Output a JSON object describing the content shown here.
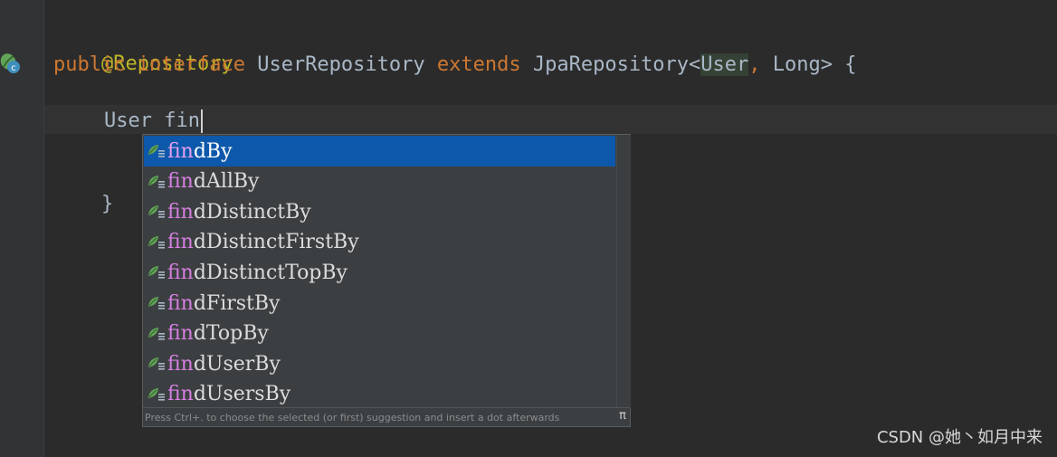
{
  "gutter": {
    "icon": "spring-repository-icon"
  },
  "code": {
    "line1": {
      "annotation": "@Repository"
    },
    "line2": {
      "kw_public": "public",
      "kw_interface": "interface",
      "name": "UserRepository",
      "kw_extends": "extends",
      "base": "JpaRepository",
      "lt": "<",
      "type1": "User",
      "comma": ",",
      "type2": "Long",
      "gt": ">",
      "brace": "{"
    },
    "line3": {
      "type": "User",
      "typed": "fin"
    },
    "line4": {
      "close_brace": "}"
    }
  },
  "completion": {
    "match_prefix": "fin",
    "items": [
      {
        "match": "fin",
        "rest": "dBy",
        "icon": "spring-method-icon",
        "selected": true
      },
      {
        "match": "fin",
        "rest": "dAllBy",
        "icon": "spring-method-icon"
      },
      {
        "match": "fin",
        "rest": "dDistinctBy",
        "icon": "spring-method-icon"
      },
      {
        "match": "fin",
        "rest": "dDistinctFirstBy",
        "icon": "spring-method-icon"
      },
      {
        "match": "fin",
        "rest": "dDistinctTopBy",
        "icon": "spring-method-icon"
      },
      {
        "match": "fin",
        "rest": "dFirstBy",
        "icon": "spring-method-icon"
      },
      {
        "match": "fin",
        "rest": "dTopBy",
        "icon": "spring-method-icon"
      },
      {
        "match": "fin",
        "rest": "dUserBy",
        "icon": "spring-method-icon"
      },
      {
        "match": "fin",
        "rest": "dUsersBy",
        "icon": "spring-method-icon"
      }
    ],
    "hint": "Press Ctrl+. to choose the selected (or first) suggestion and insert a dot afterwards",
    "hint_link": "π"
  },
  "watermark": "CSDN @她丶如月中来",
  "colors": {
    "background": "#2b2b2b",
    "keyword": "#cc7832",
    "annotation": "#bbb529",
    "selection": "#0d58aa",
    "match_highlight": "#d67fe1"
  }
}
